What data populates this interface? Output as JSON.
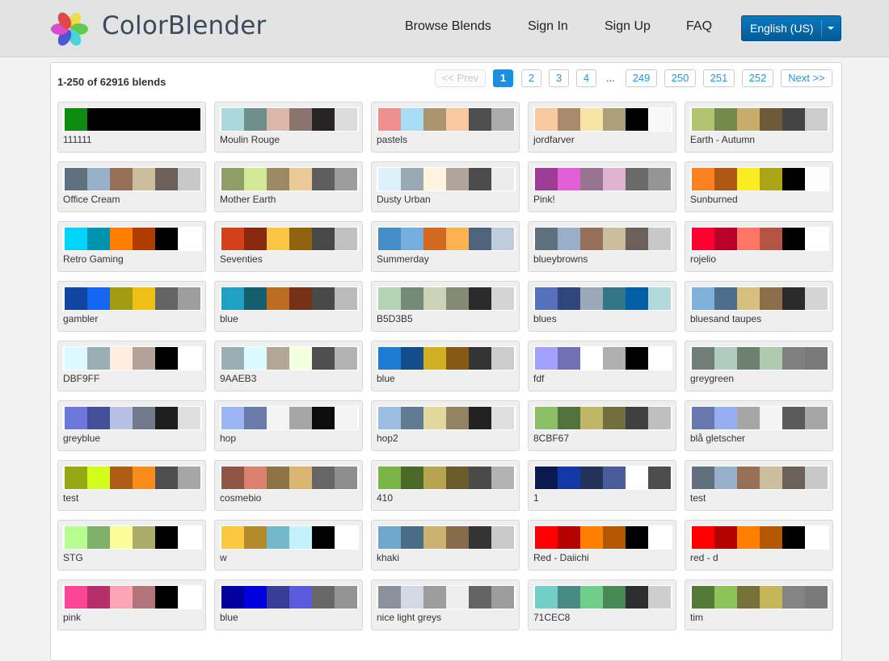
{
  "header": {
    "brand": "ColorBlender",
    "nav": [
      "Browse Blends",
      "Sign In",
      "Sign Up",
      "FAQ"
    ],
    "language": "English (US)"
  },
  "colors": {
    "accent": "#1a8ee0",
    "link": "#2a96d0",
    "lang_button": "#0a6aa8"
  },
  "summary": "1-250 of 62916 blends",
  "pagination": {
    "prev": "<< Prev",
    "pages": [
      "1",
      "2",
      "3",
      "4",
      "249",
      "250",
      "251",
      "252"
    ],
    "ellipsis": "...",
    "current": "1",
    "next": "Next >>"
  },
  "blends": [
    {
      "name": "111111",
      "colors": [
        "#0d8a10",
        "#000000",
        "#000000",
        "#000000",
        "#000000",
        "#000000"
      ]
    },
    {
      "name": "Moulin Rouge",
      "colors": [
        "#abd8db",
        "#6f8f8b",
        "#dbb8aa",
        "#8b736e",
        "#262424",
        "#dcdcdc"
      ]
    },
    {
      "name": "pastels",
      "colors": [
        "#f08f8f",
        "#a8dcf5",
        "#ab9470",
        "#f8c8a0",
        "#4e4e4e",
        "#acacac"
      ]
    },
    {
      "name": "jordfarver",
      "colors": [
        "#f8c8a0",
        "#ab8a6c",
        "#f8e4a4",
        "#aba07a",
        "#000000",
        "#f8f8f8"
      ]
    },
    {
      "name": "Earth - Autumn",
      "colors": [
        "#b2c470",
        "#738a4c",
        "#c8ac6c",
        "#6e5a38",
        "#444444",
        "#cccccc"
      ]
    },
    {
      "name": "Office Cream",
      "colors": [
        "#61707f",
        "#98afca",
        "#97705a",
        "#ccbd9d",
        "#6b605a",
        "#c8c8c8"
      ]
    },
    {
      "name": "Mother Earth",
      "colors": [
        "#8f9d68",
        "#d2e896",
        "#9c8863",
        "#ecca98",
        "#5e5e5e",
        "#9c9c9c"
      ]
    },
    {
      "name": "Dusty Urban",
      "colors": [
        "#def0fa",
        "#99aab4",
        "#fff4e0",
        "#b2a498",
        "#4c4c4c",
        "#ececec"
      ]
    },
    {
      "name": "Pink!",
      "colors": [
        "#9c3c94",
        "#e15ed8",
        "#977390",
        "#e0b4d0",
        "#6a6a6a",
        "#959595"
      ]
    },
    {
      "name": "Sunburned",
      "colors": [
        "#fc8120",
        "#ad5813",
        "#fbeb24",
        "#aba517",
        "#000000",
        "#fcfcfc"
      ]
    },
    {
      "name": "Retro Gaming",
      "colors": [
        "#00d4fc",
        "#0093b0",
        "#fd7e00",
        "#b13c00",
        "#000000",
        "#ffffff"
      ]
    },
    {
      "name": "Seventies",
      "colors": [
        "#d3411b",
        "#8a2810",
        "#fbc646",
        "#8f630e",
        "#484848",
        "#c0c0c0"
      ]
    },
    {
      "name": "Summerday",
      "colors": [
        "#458ec8",
        "#74aede",
        "#d16922",
        "#fbb24f",
        "#4f627e",
        "#c0cedc"
      ]
    },
    {
      "name": "blueybrowns",
      "colors": [
        "#61707f",
        "#98afca",
        "#97705a",
        "#ccbd9d",
        "#6b605a",
        "#c8c8c8"
      ]
    },
    {
      "name": "rojelio",
      "colors": [
        "#ff0030",
        "#b80028",
        "#ff7565",
        "#b35444",
        "#000000",
        "#ffffff"
      ]
    },
    {
      "name": "gambler",
      "colors": [
        "#0f45a0",
        "#1365f2",
        "#a39b12",
        "#edc015",
        "#646464",
        "#9e9e9e"
      ]
    },
    {
      "name": "blue",
      "colors": [
        "#22a0c4",
        "#13606c",
        "#bc6c20",
        "#753015",
        "#484848",
        "#bababa"
      ]
    },
    {
      "name": "B5D3B5",
      "colors": [
        "#b5d3b5",
        "#738a76",
        "#cdd3b6",
        "#848a76",
        "#2b2b2b",
        "#d4d4d4"
      ]
    },
    {
      "name": "blues",
      "colors": [
        "#5570bc",
        "#2e4679",
        "#9aa8b8",
        "#327685",
        "#035ea8",
        "#b2dadc"
      ]
    },
    {
      "name": "bluesand taupes",
      "colors": [
        "#7fb1dc",
        "#4d6e8c",
        "#d7c07f",
        "#8c6e4d",
        "#2b2b2b",
        "#d4d4d4"
      ]
    },
    {
      "name": "DBF9FF",
      "colors": [
        "#dbf9ff",
        "#9aaeb3",
        "#ffece0",
        "#b3a29a",
        "#000000",
        "#ffffff"
      ]
    },
    {
      "name": "9AAEB3",
      "colors": [
        "#9aaeb3",
        "#dbf9ff",
        "#b3a79a",
        "#f4ffe0",
        "#4e4e4e",
        "#b3b3b3"
      ]
    },
    {
      "name": "blue",
      "colors": [
        "#207cd0",
        "#144e8a",
        "#d2b024",
        "#845a14",
        "#343434",
        "#cccccc"
      ]
    },
    {
      "name": "fdf",
      "colors": [
        "#a2a2fc",
        "#7070b4",
        "#ffffff",
        "#b0b0b0",
        "#000000",
        "#ffffff"
      ]
    },
    {
      "name": "greygreen",
      "colors": [
        "#727f78",
        "#b0cbc0",
        "#6e8070",
        "#b0cab0",
        "#808080",
        "#7a7a7a"
      ]
    },
    {
      "name": "greyblue",
      "colors": [
        "#6c78dc",
        "#434f98",
        "#b6c0e2",
        "#737a8c",
        "#1e1e1e",
        "#dedede"
      ]
    },
    {
      "name": "hop",
      "colors": [
        "#9ab4f4",
        "#6a7baa",
        "#f4f4f4",
        "#a6a6a6",
        "#0c0c0c",
        "#f4f4f4"
      ]
    },
    {
      "name": "hop2",
      "colors": [
        "#9cbce0",
        "#627a92",
        "#e0d89c",
        "#928462",
        "#222222",
        "#dedede"
      ]
    },
    {
      "name": "8CBF67",
      "colors": [
        "#8cbf67",
        "#52733e",
        "#bfb767",
        "#736e3e",
        "#404040",
        "#bfbfbf"
      ]
    },
    {
      "name": "blå gletscher",
      "colors": [
        "#6a78b0",
        "#96aef0",
        "#a6a6a6",
        "#f4f4f4",
        "#5a5a5a",
        "#a6a6a6"
      ]
    },
    {
      "name": "test",
      "colors": [
        "#96a813",
        "#d4fb1a",
        "#ad5e14",
        "#fc8b1d",
        "#4f4f4f",
        "#a6a6a6"
      ]
    },
    {
      "name": "cosmebio",
      "colors": [
        "#905645",
        "#dc8170",
        "#8d7446",
        "#dbb572",
        "#666666",
        "#8e8e8e"
      ]
    },
    {
      "name": "410",
      "colors": [
        "#7bb547",
        "#4b6a29",
        "#b8a450",
        "#6d5c2b",
        "#4a4a4a",
        "#b3b3b3"
      ]
    },
    {
      "name": "1",
      "colors": [
        "#0b1a4e",
        "#1138a6",
        "#223258",
        "#495b9a",
        "#ffffff",
        "#4d4d4d"
      ]
    },
    {
      "name": "test",
      "colors": [
        "#61707f",
        "#98afca",
        "#97705a",
        "#ccbd9d",
        "#6b605a",
        "#c8c8c8"
      ]
    },
    {
      "name": "STG",
      "colors": [
        "#b6fc90",
        "#80b06a",
        "#fcfc9a",
        "#acac6a",
        "#000000",
        "#ffffff"
      ]
    },
    {
      "name": "w",
      "colors": [
        "#fcc840",
        "#b48a2e",
        "#74b8cc",
        "#c4f0fc",
        "#000000",
        "#ffffff"
      ]
    },
    {
      "name": "khaki",
      "colors": [
        "#70a8cc",
        "#4a6c86",
        "#ccb270",
        "#866a4a",
        "#343434",
        "#cacaca"
      ]
    },
    {
      "name": "Red - Daiichi",
      "colors": [
        "#ff0000",
        "#b50000",
        "#ff8000",
        "#b35800",
        "#000000",
        "#ffffff"
      ]
    },
    {
      "name": "red - d",
      "colors": [
        "#ff0000",
        "#b50000",
        "#ff8000",
        "#b35800",
        "#000000",
        "#ffffff"
      ]
    },
    {
      "name": "pink",
      "colors": [
        "#fc4494",
        "#b42e6a",
        "#fca4b4",
        "#b4747c",
        "#000000",
        "#ffffff"
      ]
    },
    {
      "name": "blue",
      "colors": [
        "#00009c",
        "#0000e0",
        "#383c94",
        "#5a5adc",
        "#686868",
        "#949494"
      ]
    },
    {
      "name": "nice light greys",
      "colors": [
        "#8a909c",
        "#d2d8e4",
        "#9c9c9c",
        "#eeeeee",
        "#646464",
        "#9c9c9c"
      ]
    },
    {
      "name": "71CEC8",
      "colors": [
        "#71cec8",
        "#478a84",
        "#71ce8a",
        "#478a56",
        "#2e2e2e",
        "#cecece"
      ]
    },
    {
      "name": "tim",
      "colors": [
        "#537a37",
        "#8cc45a",
        "#76703a",
        "#c6b65a",
        "#848484",
        "#7a7a7a"
      ]
    }
  ]
}
